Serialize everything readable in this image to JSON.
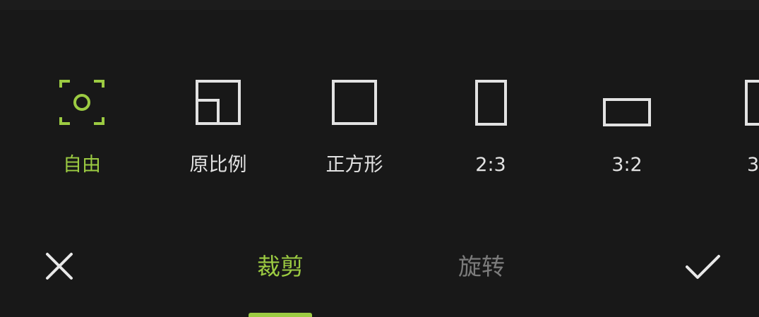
{
  "theme": {
    "accent": "#9ccb42",
    "background": "#181818",
    "icon_color": "#e2e2e2",
    "inactive_tab": "#7b7b7b"
  },
  "ratios": [
    {
      "label": "自由",
      "icon": "free-crop-icon",
      "selected": true
    },
    {
      "label": "原比例",
      "icon": "original-ratio-icon",
      "selected": false
    },
    {
      "label": "正方形",
      "icon": "square-icon",
      "selected": false
    },
    {
      "label": "2:3",
      "icon": "portrait-2-3-icon",
      "selected": false
    },
    {
      "label": "3:2",
      "icon": "landscape-3-2-icon",
      "selected": false
    },
    {
      "label": "3",
      "icon": "next-ratio-icon",
      "selected": false
    }
  ],
  "tabs": {
    "crop": "裁剪",
    "rotate": "旋转",
    "active": "crop"
  },
  "actions": {
    "cancel_icon": "close-icon",
    "confirm_icon": "checkmark-icon"
  }
}
